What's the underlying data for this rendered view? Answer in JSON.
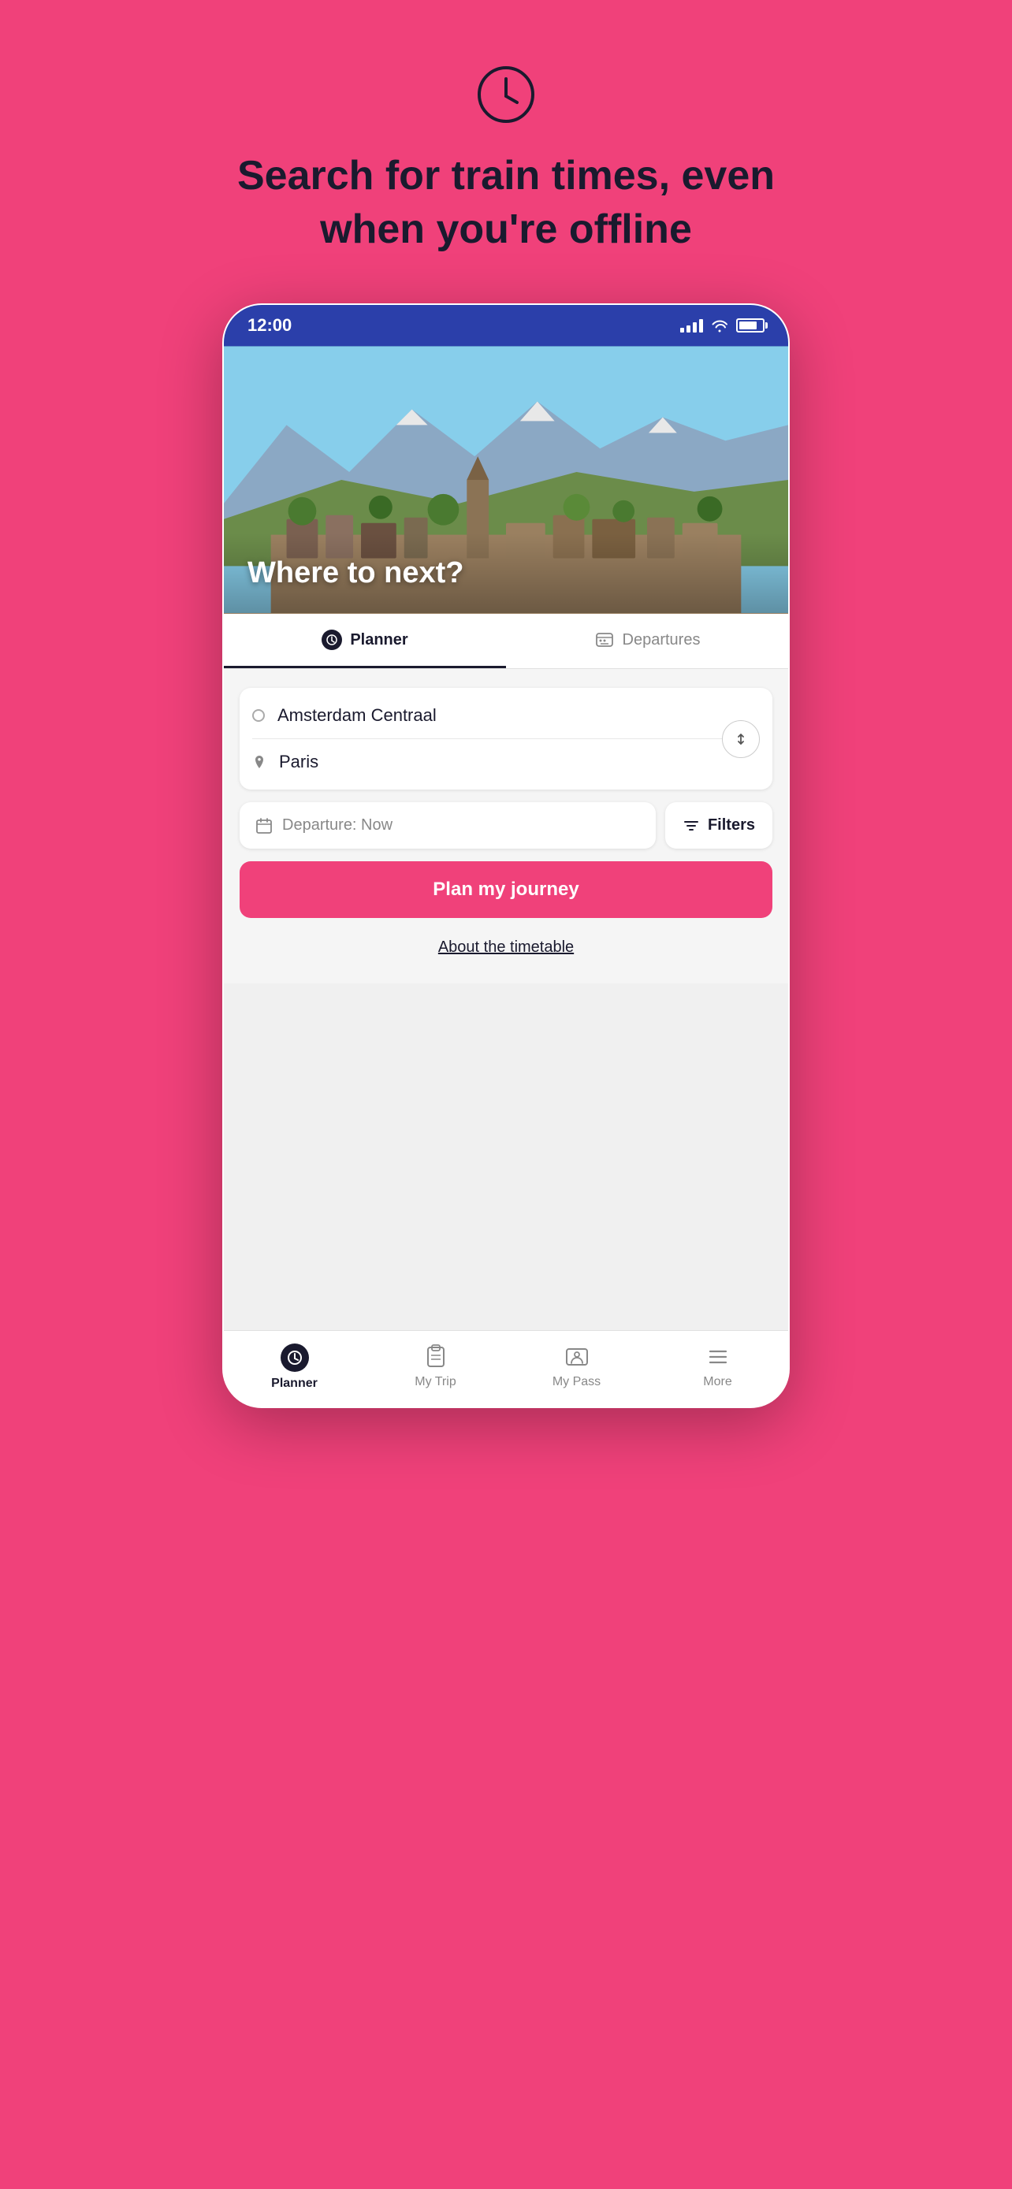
{
  "background_color": "#F0417A",
  "page": {
    "clock_icon": "🕐",
    "headline": "Search for train times, even when you're offline"
  },
  "phone": {
    "status_bar": {
      "time": "12:00",
      "signal": "signal-icon",
      "wifi": "wifi-icon",
      "battery": "battery-icon"
    },
    "hero": {
      "text": "Where to next?"
    },
    "tabs": [
      {
        "id": "planner",
        "label": "Planner",
        "active": true
      },
      {
        "id": "departures",
        "label": "Departures",
        "active": false
      }
    ],
    "search": {
      "from_station": "Amsterdam Centraal",
      "to_station": "Paris",
      "departure_placeholder": "Departure: Now",
      "filters_label": "Filters",
      "plan_button": "Plan my journey",
      "timetable_link": "About the timetable"
    },
    "bottom_nav": [
      {
        "id": "planner",
        "label": "Planner",
        "active": true
      },
      {
        "id": "my-trip",
        "label": "My Trip",
        "active": false
      },
      {
        "id": "my-pass",
        "label": "My Pass",
        "active": false
      },
      {
        "id": "more",
        "label": "More",
        "active": false
      }
    ]
  }
}
